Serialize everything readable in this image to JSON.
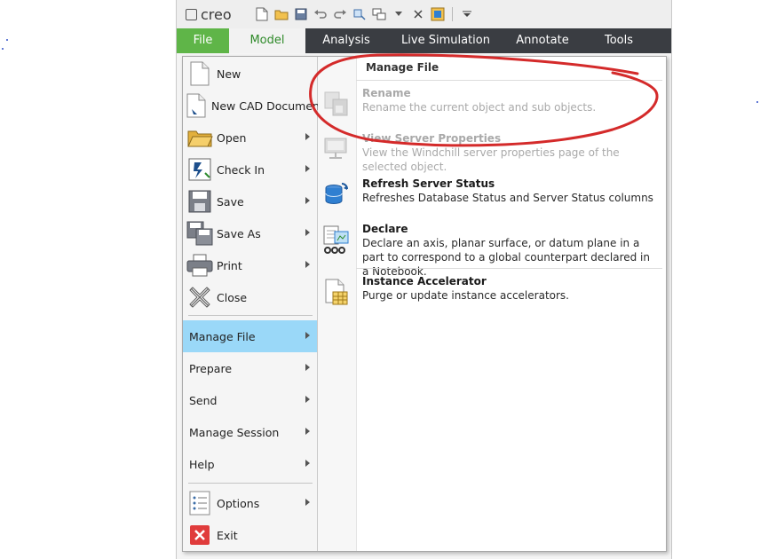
{
  "app": {
    "logo_text": "creo"
  },
  "ribbon": {
    "tabs": [
      "File",
      "Model",
      "Analysis",
      "Live Simulation",
      "Annotate",
      "Tools"
    ]
  },
  "file_menu": {
    "items": [
      {
        "label": "New"
      },
      {
        "label": "New CAD Document"
      },
      {
        "label": "Open"
      },
      {
        "label": "Check In"
      },
      {
        "label": "Save"
      },
      {
        "label": "Save As"
      },
      {
        "label": "Print"
      },
      {
        "label": "Close"
      },
      {
        "label": "Manage File"
      },
      {
        "label": "Prepare"
      },
      {
        "label": "Send"
      },
      {
        "label": "Manage Session"
      },
      {
        "label": "Help"
      },
      {
        "label": "Options"
      },
      {
        "label": "Exit"
      }
    ]
  },
  "submenu": {
    "header": "Manage File",
    "items": [
      {
        "title": "Rename",
        "desc": "Rename the current object and sub objects."
      },
      {
        "title": "View Server Properties",
        "desc": "View the Windchill server properties page of the selected object."
      },
      {
        "title": "Refresh Server Status",
        "desc": "Refreshes Database Status and Server Status columns"
      },
      {
        "title": "Declare",
        "desc": "Declare an axis, planar surface, or datum plane in a part to correspond to a global counterpart declared in a Notebook."
      },
      {
        "title": "Instance Accelerator",
        "desc": "Purge or update instance accelerators."
      }
    ]
  },
  "colors": {
    "file_tab": "#5fb548",
    "ribbon_bg": "#3a3d42",
    "menu_highlight": "#9ad8f8",
    "annotation_stroke": "#d42a2a"
  }
}
